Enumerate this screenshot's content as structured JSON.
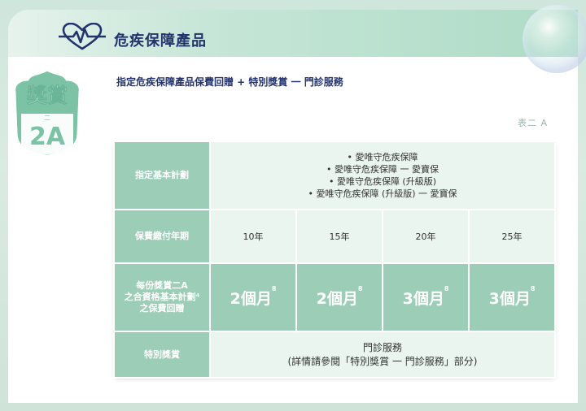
{
  "header": {
    "title": "危疾保障產品",
    "subtitle": "指定危疾保障產品保費回贈 + 特別獎賞 一 門診服務"
  },
  "badge": {
    "top": "獎賞",
    "small": "二",
    "code": "2A"
  },
  "table_label": "表二 A",
  "table": {
    "rows": {
      "plans": {
        "label": "指定基本計劃",
        "items": [
          "• 愛唯守危疾保障",
          "• 愛唯守危疾保障 一 愛寶保",
          "• 愛唯守危疾保障 (升級版)",
          "• 愛唯守危疾保障 (升級版) 一 愛寶保"
        ]
      },
      "years": {
        "label": "保費繳付年期",
        "values": [
          "10年",
          "15年",
          "20年",
          "25年"
        ]
      },
      "rebate": {
        "label_lines": [
          "每份獎賞二A",
          "之合資格基本計劃⁴",
          "之保費回贈"
        ],
        "values": [
          "2個月",
          "2個月",
          "3個月",
          "3個月"
        ],
        "footnote": "8"
      },
      "special": {
        "label": "特別獎賞",
        "line1": "門診服務",
        "line2": "(詳情請參閱「特別獎賞 一 門診服務」部分)"
      }
    }
  },
  "colors": {
    "navy": "#23336e",
    "green": "#9ccdb7",
    "light": "#eaf5ef"
  }
}
